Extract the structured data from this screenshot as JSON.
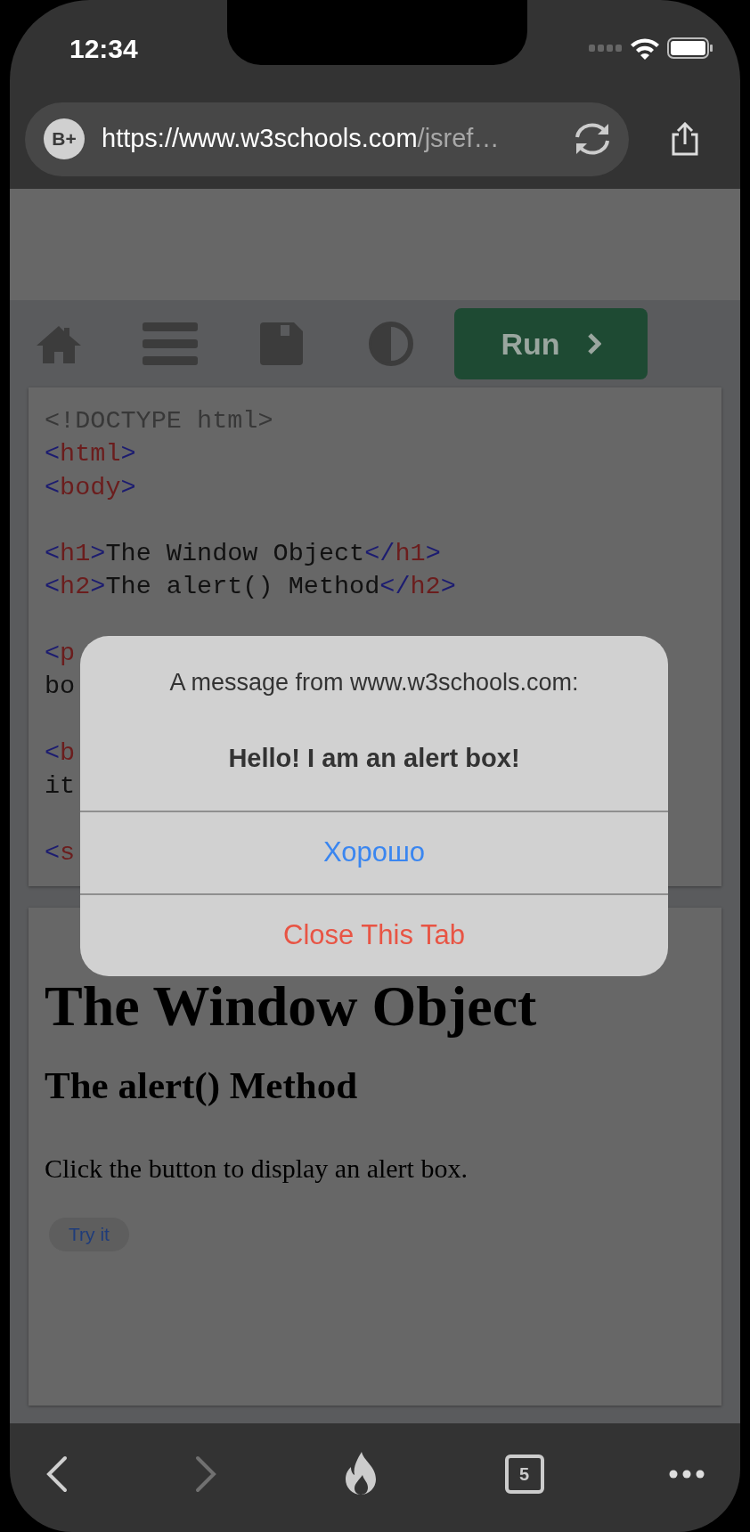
{
  "status_bar": {
    "time": "12:34"
  },
  "address_bar": {
    "badge": "B+",
    "domain": "https://www.w3schools.com",
    "path": "/jsref…"
  },
  "toolbar": {
    "run_button": "Run"
  },
  "code_lines": [
    {
      "kind": "code",
      "segments": [
        {
          "kind": "doctype",
          "text": "<!DOCTYPE html>"
        }
      ]
    },
    {
      "kind": "code",
      "segments": [
        {
          "kind": "punct",
          "text": "<"
        },
        {
          "kind": "tag",
          "text": "html"
        },
        {
          "kind": "punct",
          "text": ">"
        }
      ]
    },
    {
      "kind": "code",
      "segments": [
        {
          "kind": "punct",
          "text": "<"
        },
        {
          "kind": "tag",
          "text": "body"
        },
        {
          "kind": "punct",
          "text": ">"
        }
      ]
    },
    {
      "kind": "blank"
    },
    {
      "kind": "code",
      "segments": [
        {
          "kind": "punct",
          "text": "<"
        },
        {
          "kind": "tag",
          "text": "h1"
        },
        {
          "kind": "punct",
          "text": ">"
        },
        {
          "kind": "text",
          "text": "The Window Object"
        },
        {
          "kind": "punct",
          "text": "</"
        },
        {
          "kind": "tag",
          "text": "h1"
        },
        {
          "kind": "punct",
          "text": ">"
        }
      ]
    },
    {
      "kind": "code",
      "segments": [
        {
          "kind": "punct",
          "text": "<"
        },
        {
          "kind": "tag",
          "text": "h2"
        },
        {
          "kind": "punct",
          "text": ">"
        },
        {
          "kind": "text",
          "text": "The alert() Method"
        },
        {
          "kind": "punct",
          "text": "</"
        },
        {
          "kind": "tag",
          "text": "h2"
        },
        {
          "kind": "punct",
          "text": ">"
        }
      ]
    },
    {
      "kind": "blank"
    },
    {
      "kind": "code",
      "segments": [
        {
          "kind": "punct",
          "text": "<"
        },
        {
          "kind": "tag",
          "text": "p"
        }
      ]
    },
    {
      "kind": "code",
      "segments": [
        {
          "kind": "text",
          "text": "bo"
        }
      ]
    },
    {
      "kind": "blank"
    },
    {
      "kind": "code",
      "segments": [
        {
          "kind": "punct",
          "text": "<"
        },
        {
          "kind": "tag",
          "text": "b"
        }
      ]
    },
    {
      "kind": "code",
      "segments": [
        {
          "kind": "text",
          "text": "it"
        }
      ]
    },
    {
      "kind": "blank"
    },
    {
      "kind": "code",
      "segments": [
        {
          "kind": "punct",
          "text": "<"
        },
        {
          "kind": "tag",
          "text": "s"
        }
      ]
    }
  ],
  "result": {
    "heading": "The Window Object",
    "subheading": "The alert() Method",
    "paragraph": "Click the button to display an alert box.",
    "button": "Try it"
  },
  "alert": {
    "title": "A message from www.w3schools.com:",
    "message": "Hello! I am an alert box!",
    "buttons": [
      {
        "label": "Хорошо",
        "kind": "default"
      },
      {
        "label": "Close This Tab",
        "kind": "destructive"
      }
    ]
  },
  "bottom_bar": {
    "back": {
      "disabled": false
    },
    "forward": {
      "disabled": true
    },
    "tab_count": "5"
  }
}
